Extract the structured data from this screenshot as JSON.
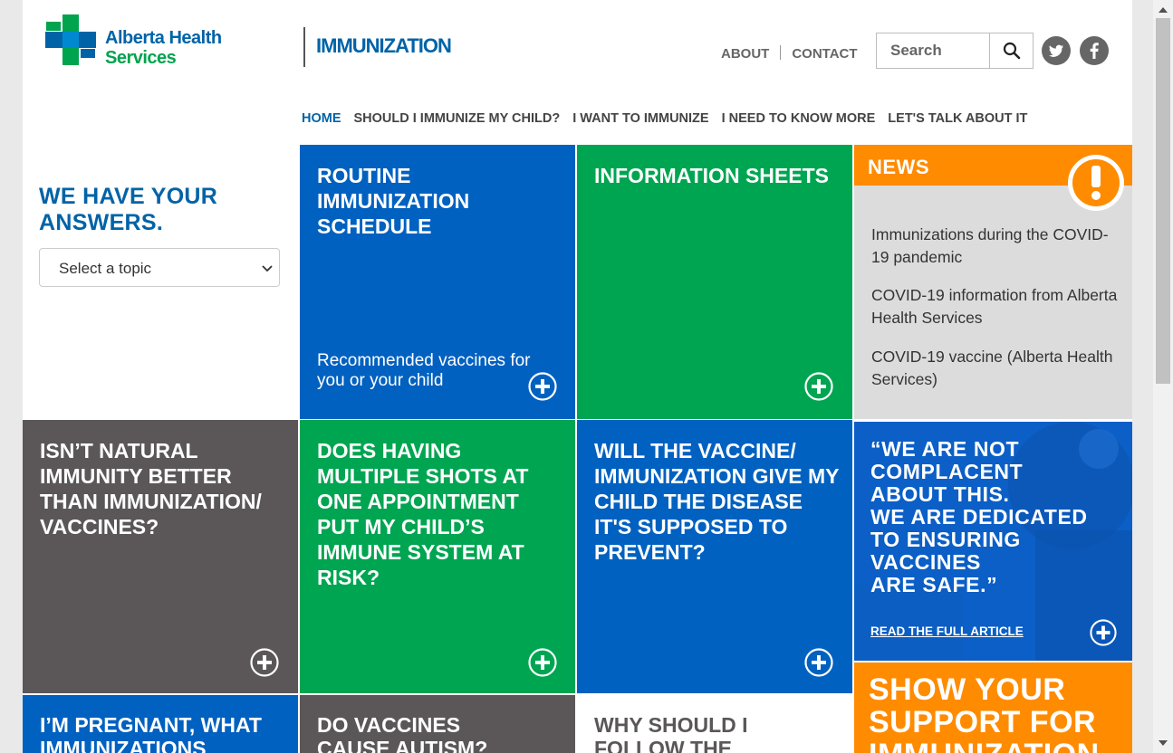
{
  "header": {
    "logo_line1": "Alberta Health",
    "logo_line2": "Services",
    "site_title": "IMMUNIZATION",
    "links": [
      "ABOUT",
      "CONTACT"
    ],
    "search_placeholder": "Search"
  },
  "nav": [
    "HOME",
    "SHOULD I IMMUNIZE MY CHILD?",
    "I WANT TO IMMUNIZE",
    "I NEED TO KNOW MORE",
    "LET'S TALK ABOUT IT"
  ],
  "answers": {
    "title_line1": "WE HAVE YOUR",
    "title_line2": "ANSWERS.",
    "select_label": "Select a topic"
  },
  "tiles": {
    "routine_title": "ROUTINE IMMUNIZATION SCHEDULE",
    "routine_desc": "Recommended vaccines for you or your child",
    "info_title": "INFORMATION SHEETS",
    "natural_title": "ISN’T NATURAL IMMUNITY BETTER THAN IMMUNIZATION/ VACCINES?",
    "multiple_title": "DOES HAVING MULTIPLE SHOTS AT ONE APPOINTMENT PUT MY CHILD’S IMMUNE SYSTEM AT RISK?",
    "disease_title": "WILL THE VACCINE/ IMMUNIZATION GIVE MY CHILD THE DISEASE IT'S SUPPOSED TO PREVENT?",
    "pregnant_title": "I’M PREGNANT, WHAT IMMUNIZATIONS",
    "autism_title": "DO VACCINES CAUSE AUTISM?",
    "follow_title": "WHY SHOULD I FOLLOW THE"
  },
  "news": {
    "title": "NEWS",
    "items": [
      "Immunizations during the COVID-19 pandemic",
      "COVID-19 information from Alberta Health Services",
      "COVID-19 vaccine (Alberta Health Services)"
    ]
  },
  "quote": {
    "l1": "“WE ARE NOT",
    "l2": "COMPLACENT",
    "l3": "ABOUT THIS.",
    "l4": "WE ARE DEDICATED",
    "l5": "TO ENSURING",
    "l6": "VACCINES",
    "l7": "ARE SAFE.”",
    "link": "READ THE FULL ARTICLE"
  },
  "support": {
    "l1": "SHOW YOUR",
    "l2": "SUPPORT FOR",
    "l3": "IMMUNIZATION"
  },
  "colors": {
    "blue": "#0061c0",
    "green": "#00a551",
    "gray": "#5b5758",
    "orange": "#ff8b00",
    "brand_blue": "#0063a7"
  }
}
